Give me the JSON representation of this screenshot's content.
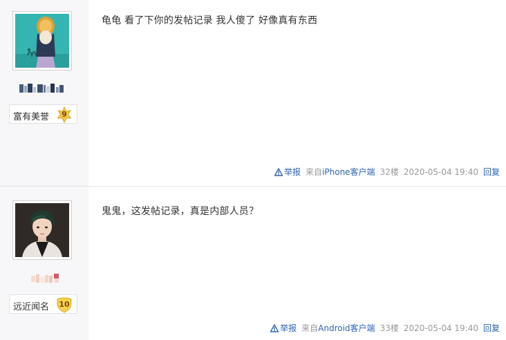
{
  "posts": [
    {
      "user": {
        "honor_title": "富有美誉",
        "level": "9"
      },
      "content": "龟龟 看了下你的发帖记录 我人傻了 好像真有东西",
      "tail": {
        "report": "举报",
        "client_prefix": "来自",
        "client": "iPhone客户端",
        "floor": "32楼",
        "time": "2020-05-04 19:40",
        "reply": "回复"
      }
    },
    {
      "user": {
        "honor_title": "远近闻名",
        "level": "10"
      },
      "content": "鬼鬼，这发帖记录，真是内部人员？",
      "tail": {
        "report": "举报",
        "client_prefix": "来自",
        "client": "Android客户端",
        "floor": "33楼",
        "time": "2020-05-04 19:40",
        "reply": "回复"
      }
    }
  ],
  "colors": {
    "link": "#2d64b3",
    "muted": "#999999",
    "sidebar_bg": "#f7f7f9",
    "badge_gold": "#f2c94c"
  }
}
